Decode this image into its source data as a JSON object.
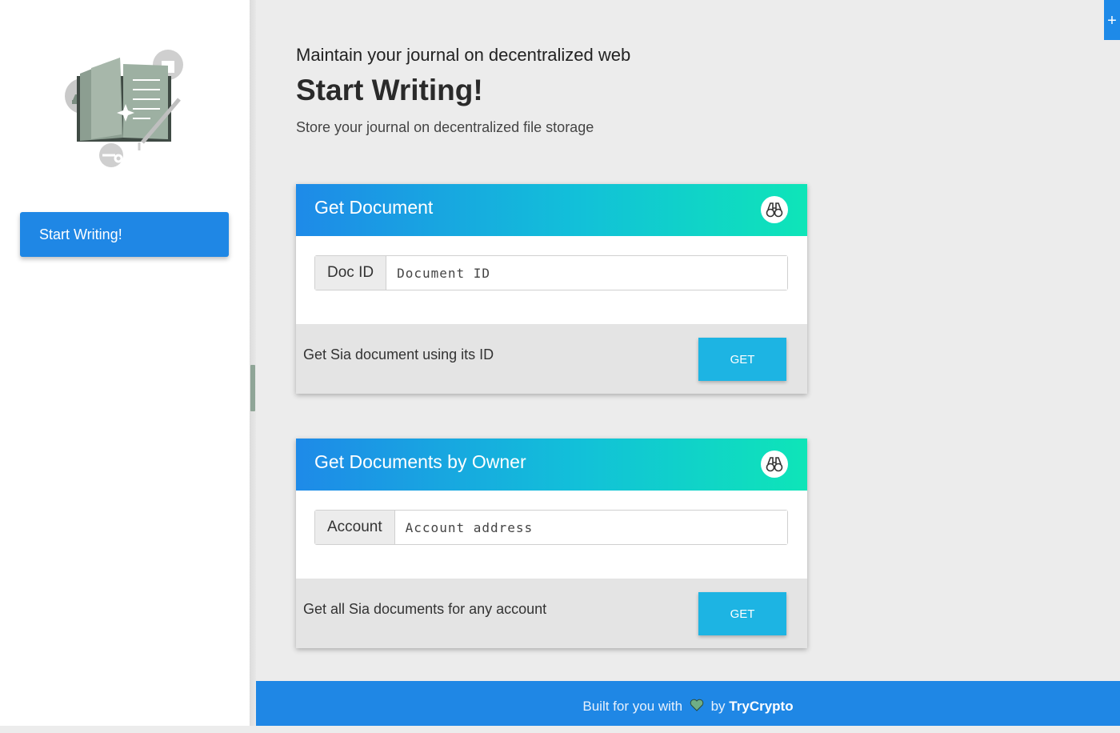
{
  "sidebar": {
    "nav_button_label": "Start Writing!"
  },
  "main": {
    "subtitle": "Maintain your journal on decentralized web",
    "title": "Start Writing!",
    "lead": "Store your journal on decentralized file storage"
  },
  "cards": [
    {
      "title": "Get Document",
      "icon": "binoculars-icon",
      "input_label": "Doc ID",
      "input_placeholder": "Document ID",
      "input_value": "",
      "description": "Get Sia document using its ID",
      "button_label": "GET"
    },
    {
      "title": "Get Documents by Owner",
      "icon": "binoculars-icon",
      "input_label": "Account",
      "input_placeholder": "Account address",
      "input_value": "",
      "description": "Get all Sia documents for any account",
      "button_label": "GET"
    }
  ],
  "footer": {
    "text_before": "Built for you with",
    "text_by": "by",
    "brand": "TryCrypto"
  },
  "corner_tab_label": "+",
  "colors": {
    "primary": "#1f87e5",
    "gradient_start": "#1e8ae8",
    "gradient_end": "#0ee5b8",
    "button": "#1db4e3"
  }
}
